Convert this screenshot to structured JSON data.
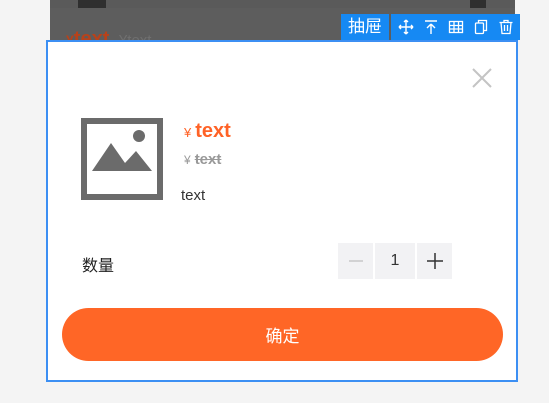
{
  "background": {
    "price": "text",
    "currency": "¥",
    "old_price": "text"
  },
  "toolbar": {
    "component_label": "抽屉",
    "icons": [
      "move-icon",
      "move-to-top-icon",
      "grid-icon",
      "copy-icon",
      "delete-icon"
    ]
  },
  "drawer": {
    "currency": "¥",
    "price": "text",
    "old_price": "text",
    "description": "text",
    "quantity_label": "数量",
    "quantity_value": "1",
    "confirm_label": "确定"
  },
  "colors": {
    "accent": "#ff6626",
    "selection": "#1689f3"
  }
}
